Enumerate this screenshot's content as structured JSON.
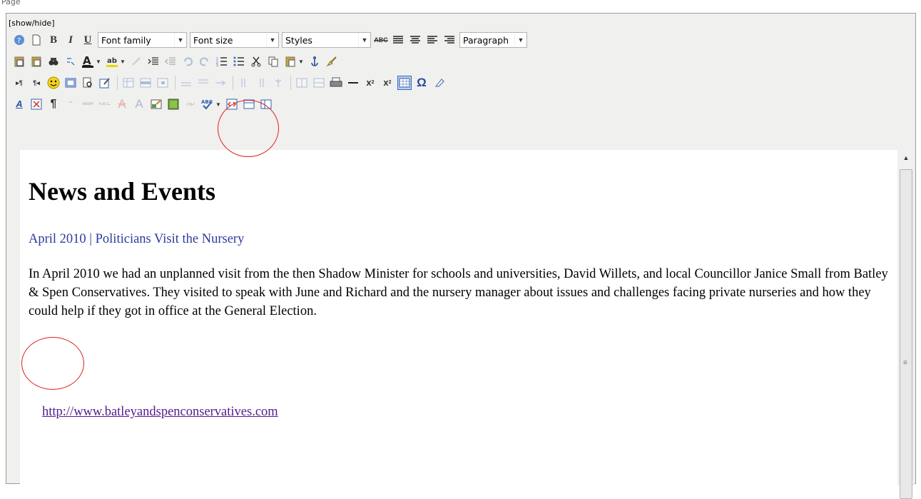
{
  "page": {
    "label": "Page"
  },
  "editor": {
    "show_hide": "[show/hide]"
  },
  "toolbar": {
    "font_family": "Font family",
    "font_size": "Font size",
    "styles": "Styles",
    "paragraph": "Paragraph",
    "bold": "B",
    "italic": "I",
    "underline": "U"
  },
  "icons": {
    "row1": [
      "help-icon",
      "new-document-icon",
      "bold-icon",
      "italic-icon",
      "underline-icon",
      "strikethrough-icon",
      "justify-full-icon",
      "align-center-icon",
      "align-left-icon",
      "align-right-icon"
    ],
    "row2": [
      "cut-from-word-icon",
      "paste-text-icon",
      "find-icon",
      "replace-icon",
      "font-color-icon",
      "highlight-color-icon",
      "unlink-icon",
      "indent-icon",
      "outdent-icon",
      "undo-icon",
      "redo-icon",
      "numbered-list-icon",
      "bullet-list-icon",
      "cut-icon",
      "copy-icon",
      "paste-icon",
      "anchor-icon",
      "cleanup-icon"
    ],
    "row3": [
      "ltr-icon",
      "rtl-icon",
      "emoticon-icon",
      "template-icon",
      "preview-icon",
      "edit-css-icon",
      "insert-table-icon",
      "row-props-icon",
      "cell-props-icon",
      "insert-row-before-icon",
      "insert-row-after-icon",
      "delete-row-icon",
      "insert-col-before-icon",
      "insert-col-after-icon",
      "delete-col-icon",
      "split-cells-icon",
      "merge-cells-icon",
      "print-icon",
      "horizontal-rule-icon",
      "subscript-icon",
      "superscript-icon",
      "visual-aid-icon",
      "special-char-icon",
      "remove-format-icon"
    ],
    "row4": [
      "style-props-icon",
      "insert-layer-icon",
      "show-blocks-icon",
      "cite-icon",
      "abbreviation-icon",
      "acronym-icon",
      "deletion-icon",
      "insertion-icon",
      "insert-image-icon",
      "image-icon",
      "link-icon",
      "spellcheck-icon",
      "html-source-icon",
      "insert-date-icon",
      "fullscreen-icon"
    ]
  },
  "content": {
    "heading": "News and Events",
    "subheading": "April 2010 | Politicians Visit the Nursery",
    "paragraph": "In April 2010 we had an unplanned visit from the then Shadow Minister for schools and universities, David Willets, and local Councillor Janice Small from Batley & Spen Conservatives.  They visited to speak with June and Richard and the nursery manager about issues and challenges facing private nurseries and how they could help if they got in office at the General Election.",
    "link": "http://www.batleyandspenconservatives.com"
  },
  "colors": {
    "annotation": "#e02020",
    "subheading": "#2d3a9c",
    "link": "#551a8b"
  }
}
